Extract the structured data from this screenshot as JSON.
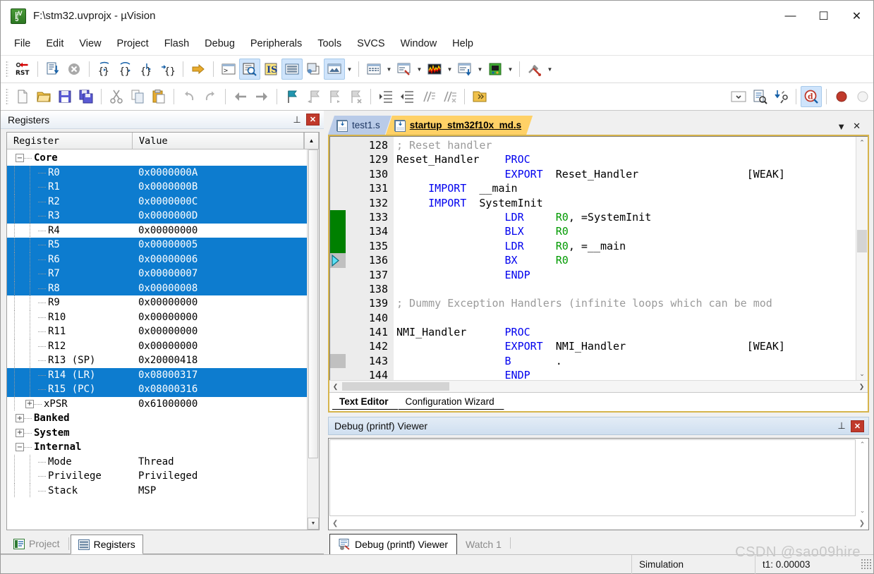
{
  "window": {
    "title": "F:\\stm32.uvprojx - µVision",
    "app_icon": "uvision-logo-icon",
    "minimize": "—",
    "maximize": "☐",
    "close": "✕"
  },
  "menubar": {
    "items": [
      {
        "label": "File",
        "name": "menu-file"
      },
      {
        "label": "Edit",
        "name": "menu-edit"
      },
      {
        "label": "View",
        "name": "menu-view"
      },
      {
        "label": "Project",
        "name": "menu-project"
      },
      {
        "label": "Flash",
        "name": "menu-flash"
      },
      {
        "label": "Debug",
        "name": "menu-debug"
      },
      {
        "label": "Peripherals",
        "name": "menu-peripherals"
      },
      {
        "label": "Tools",
        "name": "menu-tools"
      },
      {
        "label": "SVCS",
        "name": "menu-svcs"
      },
      {
        "label": "Window",
        "name": "menu-window"
      },
      {
        "label": "Help",
        "name": "menu-help"
      }
    ]
  },
  "toolbar_debug": {
    "buttons": [
      {
        "name": "reset-cpu-icon",
        "label": "RST"
      },
      {
        "name": "run-icon"
      },
      {
        "name": "stop-icon"
      },
      {
        "name": "step-into-icon"
      },
      {
        "name": "step-over-icon"
      },
      {
        "name": "step-out-icon"
      },
      {
        "name": "run-to-cursor-icon"
      },
      {
        "name": "show-next-statement-icon"
      },
      {
        "name": "command-window-icon"
      },
      {
        "name": "disassembly-window-icon"
      },
      {
        "name": "symbols-window-icon"
      },
      {
        "name": "registers-window-icon"
      },
      {
        "name": "call-stack-window-icon"
      },
      {
        "name": "watch-windows-icon"
      },
      {
        "name": "memory-windows-icon"
      },
      {
        "name": "serial-windows-icon"
      },
      {
        "name": "analysis-windows-icon"
      },
      {
        "name": "trace-windows-icon"
      },
      {
        "name": "system-viewer-icon"
      },
      {
        "name": "toolbox-icon"
      }
    ]
  },
  "toolbar_file": {
    "buttons": [
      {
        "name": "new-file-icon"
      },
      {
        "name": "open-file-icon"
      },
      {
        "name": "save-icon"
      },
      {
        "name": "save-all-icon"
      },
      {
        "name": "cut-icon"
      },
      {
        "name": "copy-icon"
      },
      {
        "name": "paste-icon"
      },
      {
        "name": "undo-icon"
      },
      {
        "name": "redo-icon"
      },
      {
        "name": "navigate-back-icon"
      },
      {
        "name": "navigate-forward-icon"
      },
      {
        "name": "insert-bookmark-icon"
      },
      {
        "name": "prev-bookmark-icon"
      },
      {
        "name": "next-bookmark-icon"
      },
      {
        "name": "clear-bookmarks-icon"
      },
      {
        "name": "indent-icon"
      },
      {
        "name": "outdent-icon"
      },
      {
        "name": "comment-icon"
      },
      {
        "name": "uncomment-icon"
      },
      {
        "name": "open-folder-icon"
      },
      {
        "name": "target-select-icon"
      },
      {
        "name": "target-options-icon"
      },
      {
        "name": "manage-components-icon"
      },
      {
        "name": "start-debug-icon"
      },
      {
        "name": "record-icon"
      },
      {
        "name": "stop-record-icon"
      }
    ]
  },
  "registers_pane": {
    "caption": "Registers",
    "pin_icon": "pin-icon",
    "close_icon": "close-icon",
    "columns": [
      "Register",
      "Value"
    ],
    "rows": [
      {
        "name": "Core",
        "value": "",
        "depth": 0,
        "expander": "−",
        "selected": false
      },
      {
        "name": "R0",
        "value": "0x0000000A",
        "depth": 2,
        "expander": "",
        "selected": true
      },
      {
        "name": "R1",
        "value": "0x0000000B",
        "depth": 2,
        "expander": "",
        "selected": true
      },
      {
        "name": "R2",
        "value": "0x0000000C",
        "depth": 2,
        "expander": "",
        "selected": true
      },
      {
        "name": "R3",
        "value": "0x0000000D",
        "depth": 2,
        "expander": "",
        "selected": true
      },
      {
        "name": "R4",
        "value": "0x00000000",
        "depth": 2,
        "expander": "",
        "selected": false
      },
      {
        "name": "R5",
        "value": "0x00000005",
        "depth": 2,
        "expander": "",
        "selected": true
      },
      {
        "name": "R6",
        "value": "0x00000006",
        "depth": 2,
        "expander": "",
        "selected": true
      },
      {
        "name": "R7",
        "value": "0x00000007",
        "depth": 2,
        "expander": "",
        "selected": true
      },
      {
        "name": "R8",
        "value": "0x00000008",
        "depth": 2,
        "expander": "",
        "selected": true
      },
      {
        "name": "R9",
        "value": "0x00000000",
        "depth": 2,
        "expander": "",
        "selected": false
      },
      {
        "name": "R10",
        "value": "0x00000000",
        "depth": 2,
        "expander": "",
        "selected": false
      },
      {
        "name": "R11",
        "value": "0x00000000",
        "depth": 2,
        "expander": "",
        "selected": false
      },
      {
        "name": "R12",
        "value": "0x00000000",
        "depth": 2,
        "expander": "",
        "selected": false
      },
      {
        "name": "R13 (SP)",
        "value": "0x20000418",
        "depth": 2,
        "expander": "",
        "selected": false
      },
      {
        "name": "R14 (LR)",
        "value": "0x08000317",
        "depth": 2,
        "expander": "",
        "selected": true
      },
      {
        "name": "R15 (PC)",
        "value": "0x08000316",
        "depth": 2,
        "expander": "",
        "selected": true
      },
      {
        "name": "xPSR",
        "value": "0x61000000",
        "depth": 1,
        "expander": "+",
        "selected": false
      },
      {
        "name": "Banked",
        "value": "",
        "depth": 0,
        "expander": "+",
        "selected": false
      },
      {
        "name": "System",
        "value": "",
        "depth": 0,
        "expander": "+",
        "selected": false
      },
      {
        "name": "Internal",
        "value": "",
        "depth": 0,
        "expander": "−",
        "selected": false
      },
      {
        "name": "Mode",
        "value": "Thread",
        "depth": 2,
        "expander": "",
        "selected": false
      },
      {
        "name": "Privilege",
        "value": "Privileged",
        "depth": 2,
        "expander": "",
        "selected": false
      },
      {
        "name": "Stack",
        "value": "MSP",
        "depth": 2,
        "expander": "",
        "selected": false
      }
    ]
  },
  "left_tabs": [
    {
      "label": "Project",
      "name": "tab-project",
      "icon": "project-icon",
      "active": false
    },
    {
      "label": "Registers",
      "name": "tab-registers",
      "icon": "registers-icon",
      "active": true
    }
  ],
  "editor": {
    "tabs": [
      {
        "label": "test1.s",
        "name": "editor-tab-test1",
        "active": false
      },
      {
        "label": "startup_stm32f10x_md.s",
        "name": "editor-tab-startup",
        "active": true
      }
    ],
    "tab_dropdown_icon": "chevron-down-icon",
    "tab_close_icon": "close-icon",
    "first_line": 128,
    "lines": [
      {
        "n": 128,
        "segments": [
          {
            "t": "; Reset handler",
            "c": "cmt",
            "pad": 0
          }
        ],
        "marker": ""
      },
      {
        "n": 129,
        "segments": [
          {
            "t": "Reset_Handler",
            "c": "",
            "pad": 0
          },
          {
            "t": "PROC",
            "c": "dir",
            "pad": 4
          }
        ],
        "marker": ""
      },
      {
        "n": 130,
        "segments": [
          {
            "t": "EXPORT",
            "c": "dir",
            "pad": 17
          },
          {
            "t": "Reset_Handler",
            "c": "",
            "pad": 2
          },
          {
            "t": "[WEAK]",
            "c": "",
            "pad": 17
          }
        ],
        "marker": ""
      },
      {
        "n": 131,
        "segments": [
          {
            "t": "IMPORT",
            "c": "dir",
            "pad": 5
          },
          {
            "t": "__main",
            "c": "",
            "pad": 2
          }
        ],
        "marker": ""
      },
      {
        "n": 132,
        "segments": [
          {
            "t": "IMPORT",
            "c": "dir",
            "pad": 5
          },
          {
            "t": "SystemInit",
            "c": "",
            "pad": 2
          }
        ],
        "marker": ""
      },
      {
        "n": 133,
        "segments": [
          {
            "t": "LDR",
            "c": "dir",
            "pad": 17
          },
          {
            "t": "R0",
            "c": "reg",
            "pad": 5
          },
          {
            "t": ", =SystemInit",
            "c": "",
            "pad": 0
          }
        ],
        "marker": "green"
      },
      {
        "n": 134,
        "segments": [
          {
            "t": "BLX",
            "c": "dir",
            "pad": 17
          },
          {
            "t": "R0",
            "c": "reg",
            "pad": 5
          }
        ],
        "marker": "green"
      },
      {
        "n": 135,
        "segments": [
          {
            "t": "LDR",
            "c": "dir",
            "pad": 17
          },
          {
            "t": "R0",
            "c": "reg",
            "pad": 5
          },
          {
            "t": ", =__main",
            "c": "",
            "pad": 0
          }
        ],
        "marker": "green"
      },
      {
        "n": 136,
        "segments": [
          {
            "t": "BX",
            "c": "dir",
            "pad": 17
          },
          {
            "t": "R0",
            "c": "reg",
            "pad": 6
          }
        ],
        "marker": "pc"
      },
      {
        "n": 137,
        "segments": [
          {
            "t": "ENDP",
            "c": "dir",
            "pad": 17
          }
        ],
        "marker": ""
      },
      {
        "n": 138,
        "segments": [],
        "marker": ""
      },
      {
        "n": 139,
        "segments": [
          {
            "t": "; Dummy Exception Handlers (infinite loops which can be mod",
            "c": "cmt",
            "pad": 0
          }
        ],
        "marker": ""
      },
      {
        "n": 140,
        "segments": [],
        "marker": ""
      },
      {
        "n": 141,
        "segments": [
          {
            "t": "NMI_Handler",
            "c": "",
            "pad": 0
          },
          {
            "t": "PROC",
            "c": "dir",
            "pad": 6
          }
        ],
        "marker": ""
      },
      {
        "n": 142,
        "segments": [
          {
            "t": "EXPORT",
            "c": "dir",
            "pad": 17
          },
          {
            "t": "NMI_Handler",
            "c": "",
            "pad": 2
          },
          {
            "t": "[WEAK]",
            "c": "",
            "pad": 19
          }
        ],
        "marker": ""
      },
      {
        "n": 143,
        "segments": [
          {
            "t": "B",
            "c": "dir",
            "pad": 17
          },
          {
            "t": ".",
            "c": "",
            "pad": 7
          }
        ],
        "marker": "gray"
      },
      {
        "n": 144,
        "segments": [
          {
            "t": "ENDP",
            "c": "dir",
            "pad": 17
          }
        ],
        "marker": ""
      }
    ],
    "bottom_tabs": [
      {
        "label": "Text Editor",
        "name": "tab-text-editor",
        "active": true
      },
      {
        "label": "Configuration Wizard",
        "name": "tab-configuration-wizard",
        "active": false
      }
    ]
  },
  "debug_viewer": {
    "caption": "Debug (printf) Viewer",
    "pin_icon": "pin-icon",
    "close_icon": "close-icon",
    "content": "",
    "tabs": [
      {
        "label": "Debug (printf) Viewer",
        "name": "tab-debug-printf-viewer",
        "icon": "debug-viewer-icon",
        "active": true
      },
      {
        "label": "Watch 1",
        "name": "tab-watch-1",
        "icon": "",
        "active": false
      }
    ]
  },
  "statusbar": {
    "target": "Simulation",
    "time": "t1: 0.00003"
  },
  "watermark": "CSDN @sao09hire",
  "colors": {
    "selection_blue": "#0d7ccf",
    "active_tab_yellow": "#ffd166",
    "inactive_tab_blue": "#b9cbe8",
    "directive_blue": "#0000ee",
    "register_green": "#009a00",
    "comment_gray": "#9a9a9a",
    "exec_marker_green": "#008000",
    "caption_blue": "#cfdff0"
  }
}
